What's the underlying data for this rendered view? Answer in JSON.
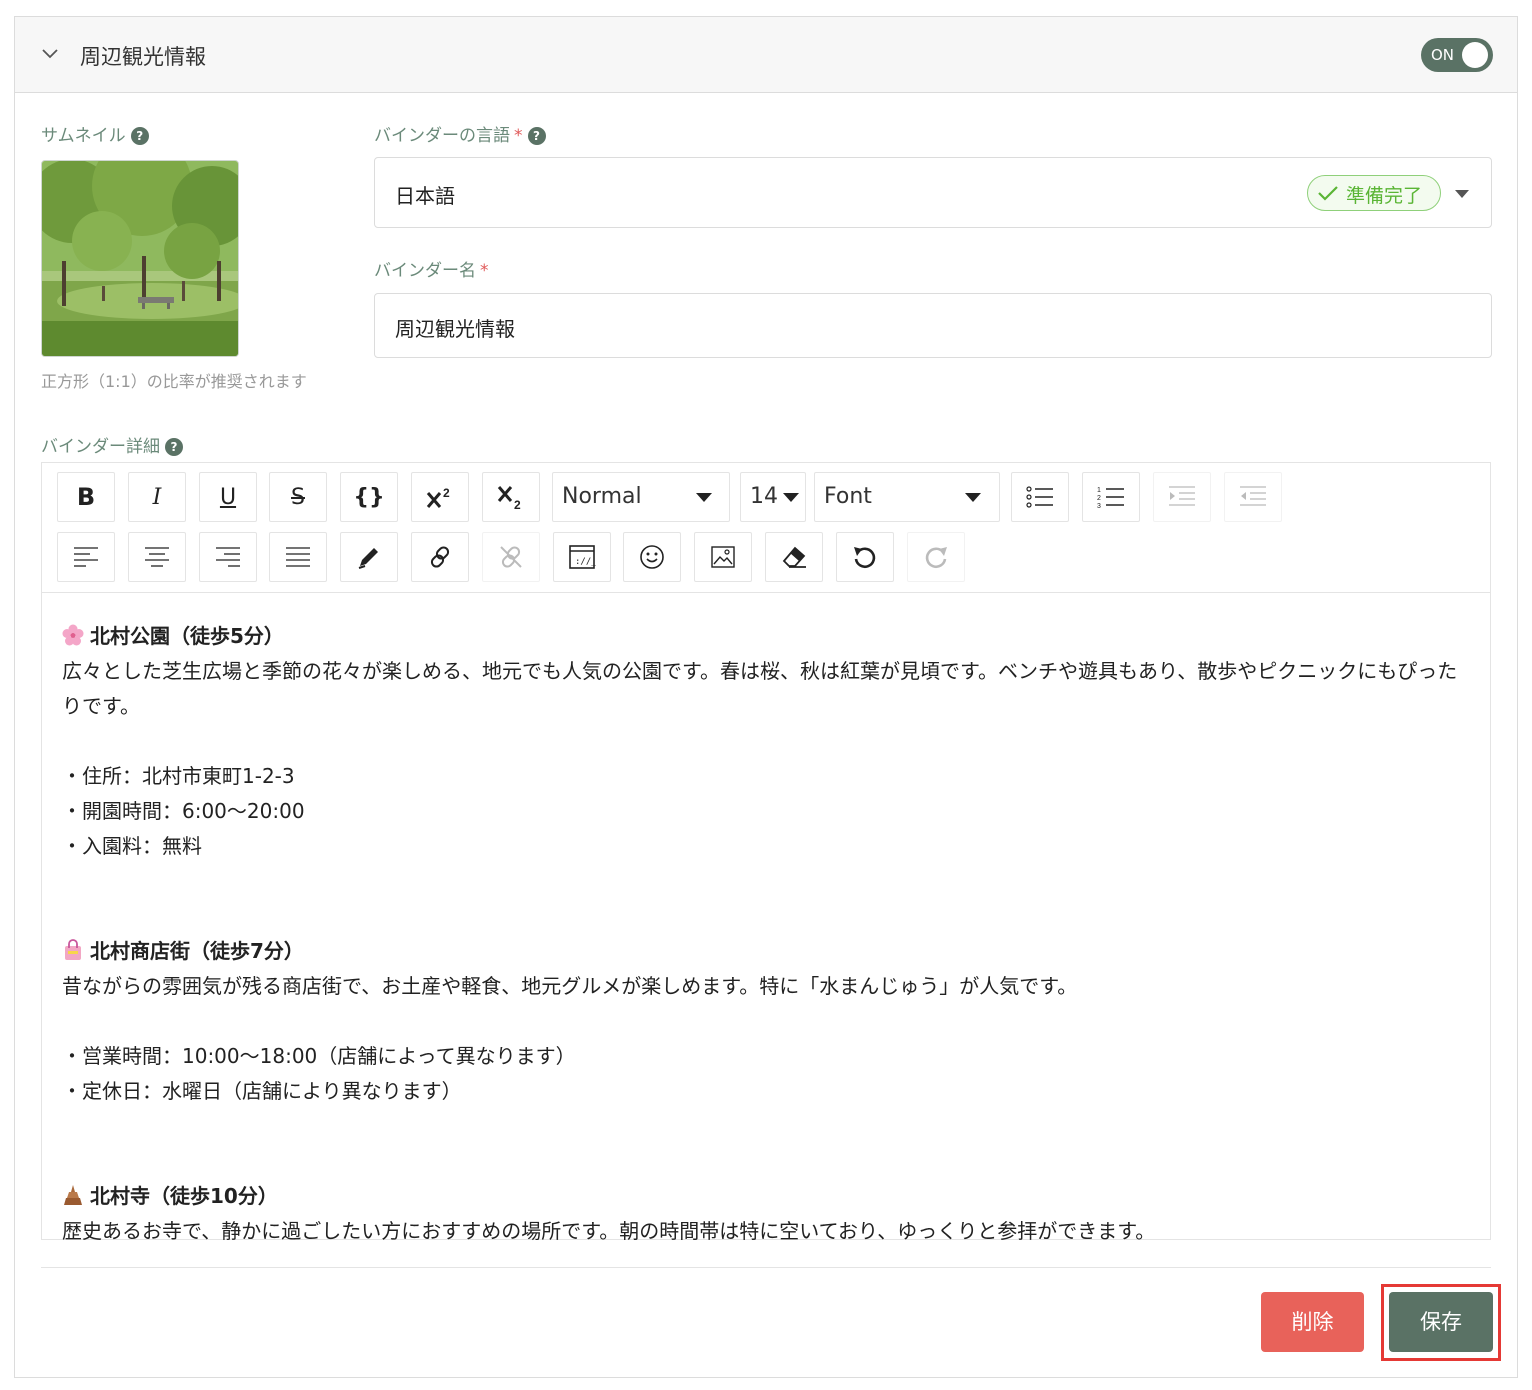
{
  "section": {
    "title": "周辺観光情報",
    "toggle_label": "ON",
    "toggle_on": true
  },
  "thumbnail": {
    "label": "サムネイル",
    "help": "?",
    "hint": "正方形（1:1）の比率が推奨されます",
    "image": "park-photo"
  },
  "language": {
    "label": "バインダーの言語",
    "required_mark": "*",
    "help": "?",
    "value": "日本語",
    "status_badge": "準備完了"
  },
  "binder_name": {
    "label": "バインダー名",
    "required_mark": "*",
    "value": "周辺観光情報"
  },
  "details": {
    "label": "バインダー詳細",
    "help": "?",
    "toolbar": {
      "bold": "B",
      "italic": "I",
      "underline": "U",
      "strike": "S",
      "code": "{}",
      "format_select": "Normal",
      "size_select": "14",
      "font_select": "Font"
    },
    "content": [
      {
        "emoji": "cherry-blossom-icon",
        "text": "北村公園（徒歩5分）",
        "bold": true
      },
      {
        "text": "広々とした芝生広場と季節の花々が楽しめる、地元でも人気の公園です。春は桜、秋は紅葉が見頃です。ベンチや遊具もあり、散歩やピクニックにもぴったりです。"
      },
      {
        "text": ""
      },
      {
        "text": "・住所：北村市東町1-2-3"
      },
      {
        "text": "・開園時間：6:00〜20:00"
      },
      {
        "text": "・入園料：無料"
      },
      {
        "text": ""
      },
      {
        "text": ""
      },
      {
        "emoji": "shopping-bag-icon",
        "text": "北村商店街（徒歩7分）",
        "bold": true
      },
      {
        "text": "昔ながらの雰囲気が残る商店街で、お土産や軽食、地元グルメが楽しめます。特に「水まんじゅう」が人気です。"
      },
      {
        "text": ""
      },
      {
        "text": "・営業時間：10:00〜18:00（店舗によって異なります）"
      },
      {
        "text": "・定休日：水曜日（店舗により異なります）"
      },
      {
        "text": ""
      },
      {
        "text": ""
      },
      {
        "emoji": "temple-icon",
        "text": "北村寺（徒歩10分）",
        "bold": true
      },
      {
        "text": "歴史あるお寺で、静かに過ごしたい方におすすめの場所です。朝の時間帯は特に空いており、ゆっくりと参拝ができます。"
      }
    ]
  },
  "actions": {
    "delete_label": "削除",
    "save_label": "保存"
  },
  "colors": {
    "primary": "#5a7265",
    "danger": "#e8625a",
    "success": "#5ab535",
    "highlight": "#e53935"
  }
}
